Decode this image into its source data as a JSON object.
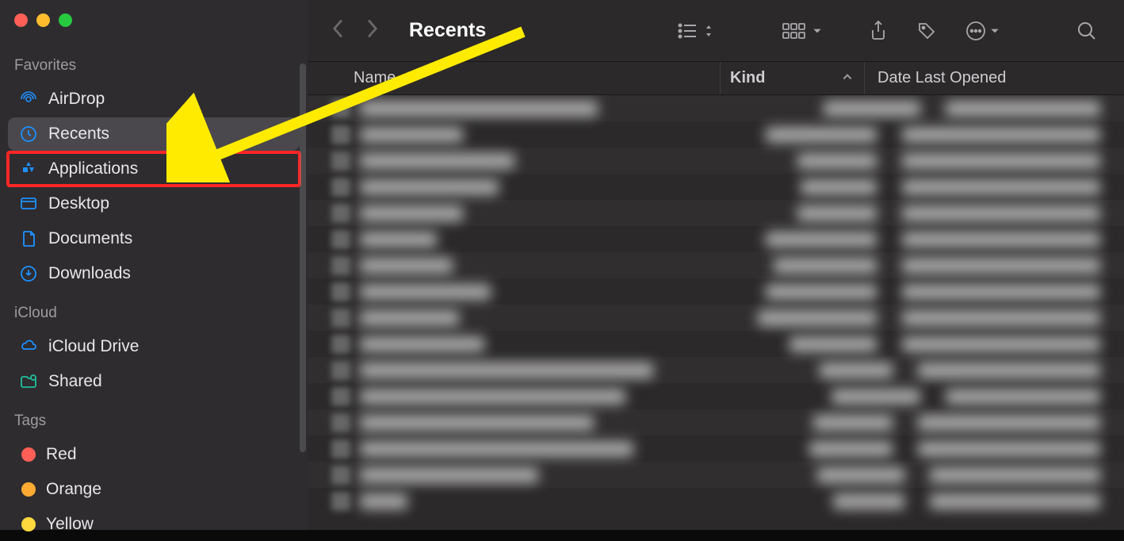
{
  "window": {
    "title": "Recents"
  },
  "sidebar": {
    "sections": [
      {
        "header": "Favorites",
        "items": [
          {
            "icon": "airdrop-icon",
            "label": "AirDrop"
          },
          {
            "icon": "clock-icon",
            "label": "Recents",
            "selected": true
          },
          {
            "icon": "apps-icon",
            "label": "Applications",
            "highlighted": true
          },
          {
            "icon": "desktop-icon",
            "label": "Desktop"
          },
          {
            "icon": "document-icon",
            "label": "Documents"
          },
          {
            "icon": "download-icon",
            "label": "Downloads"
          }
        ]
      },
      {
        "header": "iCloud",
        "items": [
          {
            "icon": "cloud-icon",
            "label": "iCloud Drive"
          },
          {
            "icon": "shared-icon",
            "label": "Shared"
          }
        ]
      },
      {
        "header": "Tags",
        "items": [
          {
            "icon": "tag-dot",
            "label": "Red",
            "color": "#ff5f56"
          },
          {
            "icon": "tag-dot",
            "label": "Orange",
            "color": "#ffaa33"
          },
          {
            "icon": "tag-dot",
            "label": "Yellow",
            "color": "#ffd93d"
          }
        ]
      }
    ]
  },
  "columns": {
    "name": "Name",
    "kind": "Kind",
    "date": "Date Last Opened"
  },
  "rows_count": 16,
  "row_name_widths": [
    300,
    130,
    195,
    175,
    130,
    97,
    117,
    165,
    125,
    157,
    370,
    335,
    295,
    345,
    225,
    60
  ],
  "row_kind_widths": [
    122,
    140,
    100,
    96,
    100,
    140,
    130,
    140,
    150,
    110,
    92,
    112,
    100,
    105,
    110,
    90
  ],
  "row_date_widths": [
    195,
    250,
    250,
    250,
    250,
    250,
    250,
    250,
    250,
    250,
    230,
    195,
    230,
    230,
    215,
    215
  ]
}
